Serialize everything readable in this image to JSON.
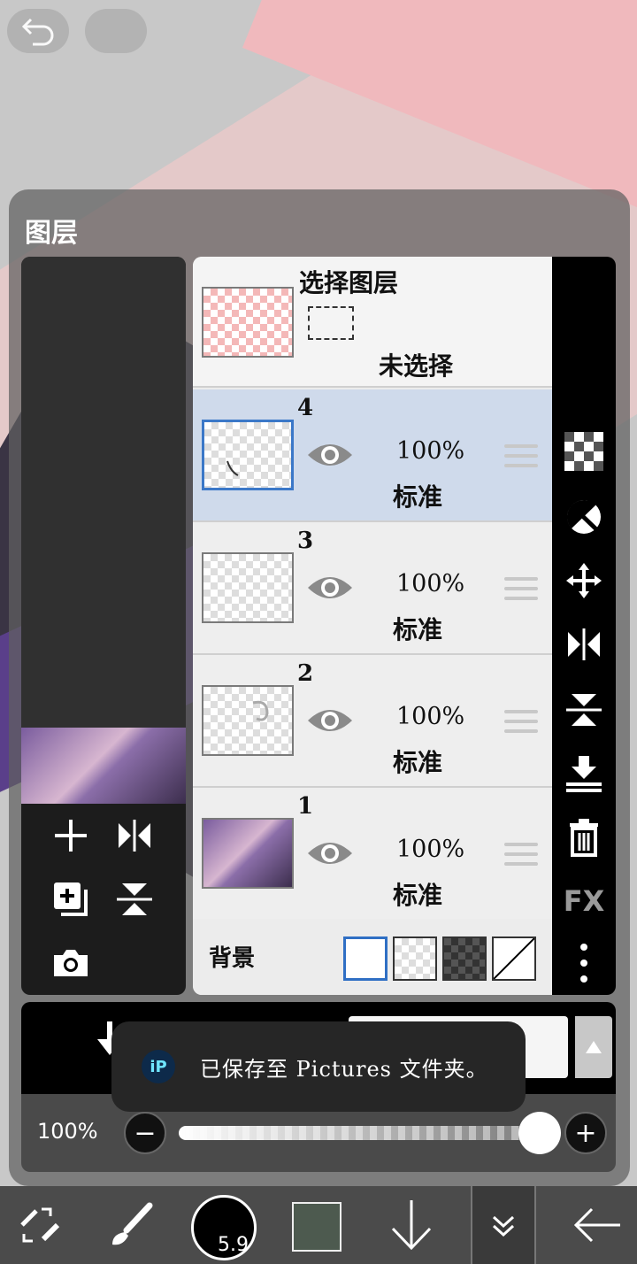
{
  "panel": {
    "title": "图层"
  },
  "selection_layer": {
    "title": "选择图层",
    "status": "未选择"
  },
  "layers": [
    {
      "number": "4",
      "opacity": "100%",
      "blend": "标准",
      "selected": true
    },
    {
      "number": "3",
      "opacity": "100%",
      "blend": "标准",
      "selected": false
    },
    {
      "number": "2",
      "opacity": "100%",
      "blend": "标准",
      "selected": false
    },
    {
      "number": "1",
      "opacity": "100%",
      "blend": "标准",
      "selected": false
    }
  ],
  "background": {
    "label": "背景",
    "options": [
      "white",
      "transparent",
      "dark-checker",
      "none"
    ],
    "selected": "white"
  },
  "side_tools": {
    "fx_label": "FX"
  },
  "opacity_row": {
    "value_label": "100%",
    "minus": "−",
    "plus": "+"
  },
  "toast": {
    "message": "已保存至 Pictures 文件夹。"
  },
  "toolbar": {
    "brush_size": "5.9"
  },
  "colors": {
    "selected_row": "#cfdaeb",
    "selected_border": "#3b78c8",
    "current_color": "#4d5a4f"
  },
  "icons": [
    "undo-icon",
    "menu-icon",
    "plus-icon",
    "flip-horizontal-icon",
    "add-layer-icon",
    "flip-vertical-icon",
    "camera-icon",
    "transparency-icon",
    "clip-icon",
    "move-icon",
    "merge-down-icon",
    "delete-icon",
    "more-icon",
    "eye-icon",
    "drag-handle-icon",
    "transform-icon",
    "brush-icon",
    "arrow-down-icon",
    "chevron-double-down-icon",
    "back-arrow-icon"
  ]
}
